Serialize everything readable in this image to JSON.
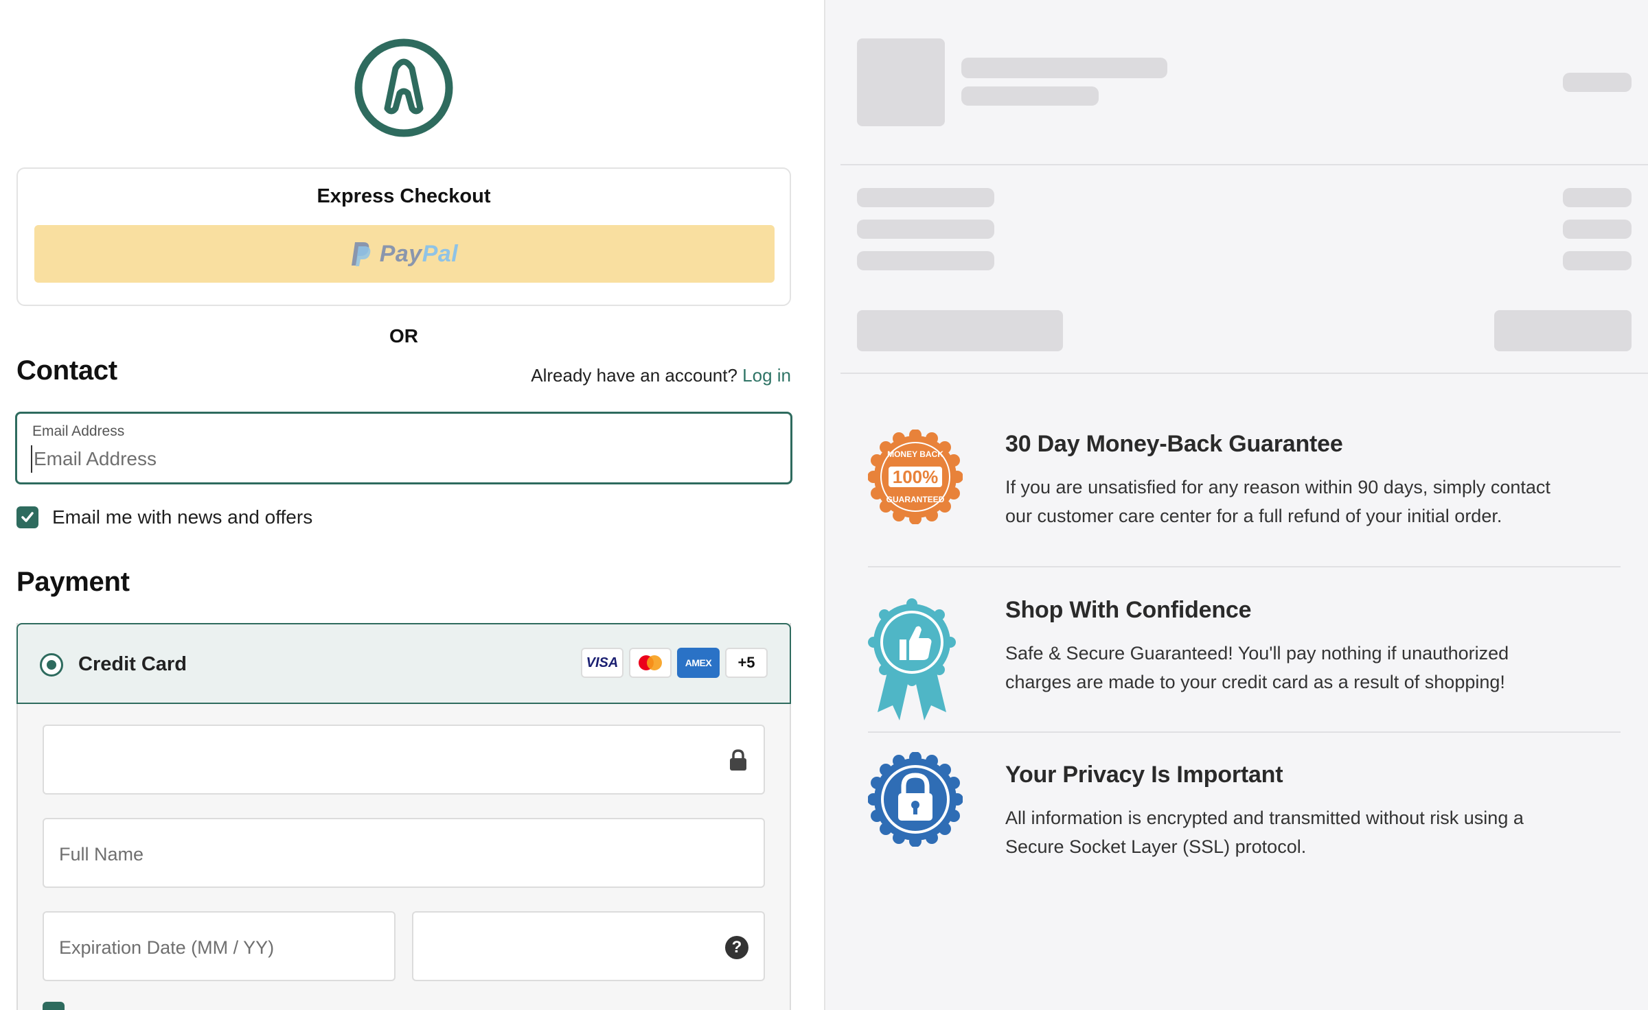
{
  "brand": {
    "logo_color": "#2e6b5e"
  },
  "express": {
    "title": "Express Checkout",
    "paypal_pay": "Pay",
    "paypal_pal": "Pal",
    "button_color": "#f9dfa0"
  },
  "divider_or": "OR",
  "contact": {
    "title": "Contact",
    "account_prompt": "Already have an account?",
    "login_link": "Log in",
    "email_label": "Email Address",
    "email_placeholder": "Email Address",
    "email_value": "",
    "newsletter_label": "Email me with news and offers",
    "newsletter_checked": true
  },
  "payment": {
    "title": "Payment",
    "method_label": "Credit Card",
    "method_selected": true,
    "card_brands": [
      "VISA",
      "mastercard",
      "AMEX"
    ],
    "more_brands": "+5",
    "fields": {
      "card_number": "",
      "full_name": "Full Name",
      "expiration": "Expiration Date (MM / YY)",
      "cvv": ""
    },
    "cvv_help_icon": "question-circle-icon",
    "card_lock_icon": "lock-icon"
  },
  "guarantees": [
    {
      "title": "30 Day Money-Back Guarantee",
      "body_line1": "If you are unsatisfied for any reason within 90 days, simply contact",
      "body_line2": "our customer care center for a full refund of your initial order.",
      "badge_text_top": "MONEY BACK",
      "badge_value": "100%",
      "badge_text_bottom": "GUARANTEED",
      "badge_color": "#e8823a"
    },
    {
      "title": "Shop With Confidence",
      "body_line1": "Safe & Secure Guaranteed! You'll pay nothing if unauthorized",
      "body_line2": "charges are made to your credit card as a result of shopping!",
      "badge_color": "#4fb6c6"
    },
    {
      "title": "Your Privacy Is Important",
      "body_line1": "All information is encrypted and transmitted without risk using a",
      "body_line2": "Secure Socket Layer (SSL) protocol.",
      "badge_color": "#2f6db5"
    }
  ],
  "colors": {
    "accent": "#2e6b5e",
    "link": "#2f7466",
    "skeleton": "#dcdbde",
    "right_bg": "#f5f5f7"
  }
}
